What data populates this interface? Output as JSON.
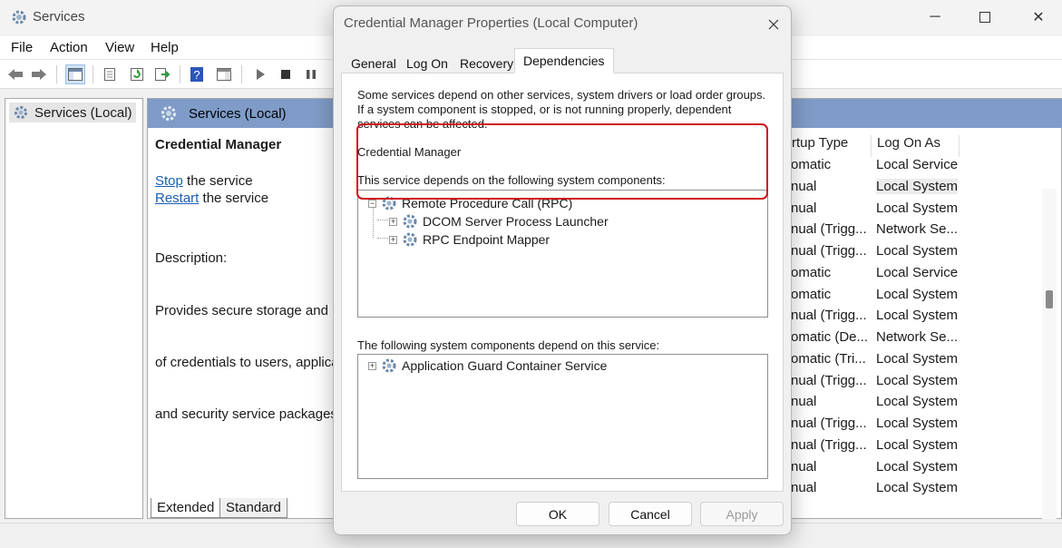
{
  "window": {
    "title": "Services"
  },
  "menu": [
    "File",
    "Action",
    "View",
    "Help"
  ],
  "tree": {
    "root": "Services (Local)"
  },
  "pane": {
    "header": "Services (Local)",
    "service_title": "Credential Manager",
    "stop_link": "Stop",
    "stop_rest": " the service",
    "restart_link": "Restart",
    "restart_rest": " the service",
    "description_label": "Description:",
    "description_lines": [
      "Provides secure storage and re",
      "of credentials to users, applica",
      "and security service packages."
    ]
  },
  "columns": {
    "startup_type": "rtup Type",
    "log_on_as": "Log On As"
  },
  "rows": [
    {
      "startup": "omatic",
      "logon": "Local Service"
    },
    {
      "startup": "nual",
      "logon": "Local System"
    },
    {
      "startup": "nual",
      "logon": "Local System"
    },
    {
      "startup": "nual (Trigg...",
      "logon": "Network Se..."
    },
    {
      "startup": "nual (Trigg...",
      "logon": "Local System"
    },
    {
      "startup": "omatic",
      "logon": "Local Service"
    },
    {
      "startup": "omatic",
      "logon": "Local System"
    },
    {
      "startup": "nual (Trigg...",
      "logon": "Local System"
    },
    {
      "startup": "omatic (De...",
      "logon": "Network Se..."
    },
    {
      "startup": "omatic (Tri...",
      "logon": "Local System"
    },
    {
      "startup": "nual (Trigg...",
      "logon": "Local System"
    },
    {
      "startup": "nual",
      "logon": "Local System"
    },
    {
      "startup": "nual (Trigg...",
      "logon": "Local System"
    },
    {
      "startup": "nual (Trigg...",
      "logon": "Local System"
    },
    {
      "startup": "nual",
      "logon": "Local System"
    },
    {
      "startup": "nual",
      "logon": "Local System"
    }
  ],
  "bottom_tabs": [
    "Extended",
    "Standard"
  ],
  "dialog": {
    "title": "Credential Manager Properties (Local Computer)",
    "tabs": [
      "General",
      "Log On",
      "Recovery",
      "Dependencies"
    ],
    "active_tab": "Dependencies",
    "intro_lines": [
      "Some services depend on other services, system drivers or load order groups.",
      "If a system component is stopped, or is not running properly, dependent",
      "services can be affected."
    ],
    "service_name": "Credential Manager",
    "depends_on_label": "This service depends on the following system components:",
    "depends_on": {
      "root": "Remote Procedure Call (RPC)",
      "children": [
        "DCOM Server Process Launcher",
        "RPC Endpoint Mapper"
      ]
    },
    "dependents_label": "The following system components depend on this service:",
    "dependents": [
      "Application Guard Container Service"
    ],
    "buttons": {
      "ok": "OK",
      "cancel": "Cancel",
      "apply": "Apply"
    }
  },
  "colors": {
    "header_blue": "#7f9cc8",
    "highlight_red": "#d0131b",
    "link_blue": "#1a5fb4"
  }
}
